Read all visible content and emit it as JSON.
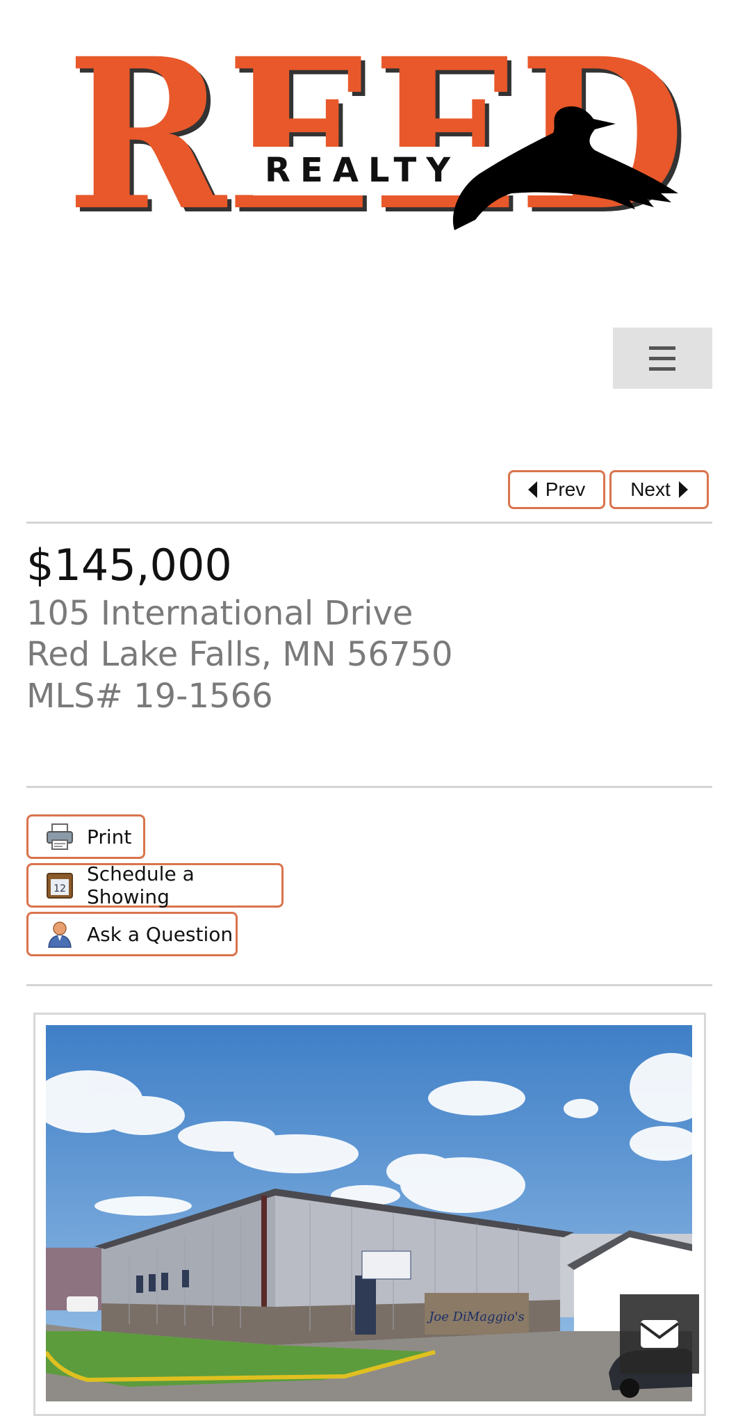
{
  "header": {
    "logo_text": "REED",
    "logo_subtext": "REALTY",
    "menu_icon": "hamburger-icon"
  },
  "navigation": {
    "prev_label": "Prev",
    "next_label": "Next"
  },
  "listing": {
    "price": "$145,000",
    "street": "105 International Drive",
    "city_state_zip": "Red Lake Falls, MN 56750",
    "mls": "MLS# 19-1566"
  },
  "actions": {
    "print_label": "Print",
    "schedule_label": "Schedule a Showing",
    "question_label": "Ask a Question"
  },
  "photo": {
    "sign_text": "Joe DiMaggio's"
  },
  "floating": {
    "mail_icon": "envelope-icon"
  },
  "colors": {
    "brand_orange": "#e8582a",
    "button_border": "#d9734c",
    "address_gray": "#7a7a7a"
  }
}
